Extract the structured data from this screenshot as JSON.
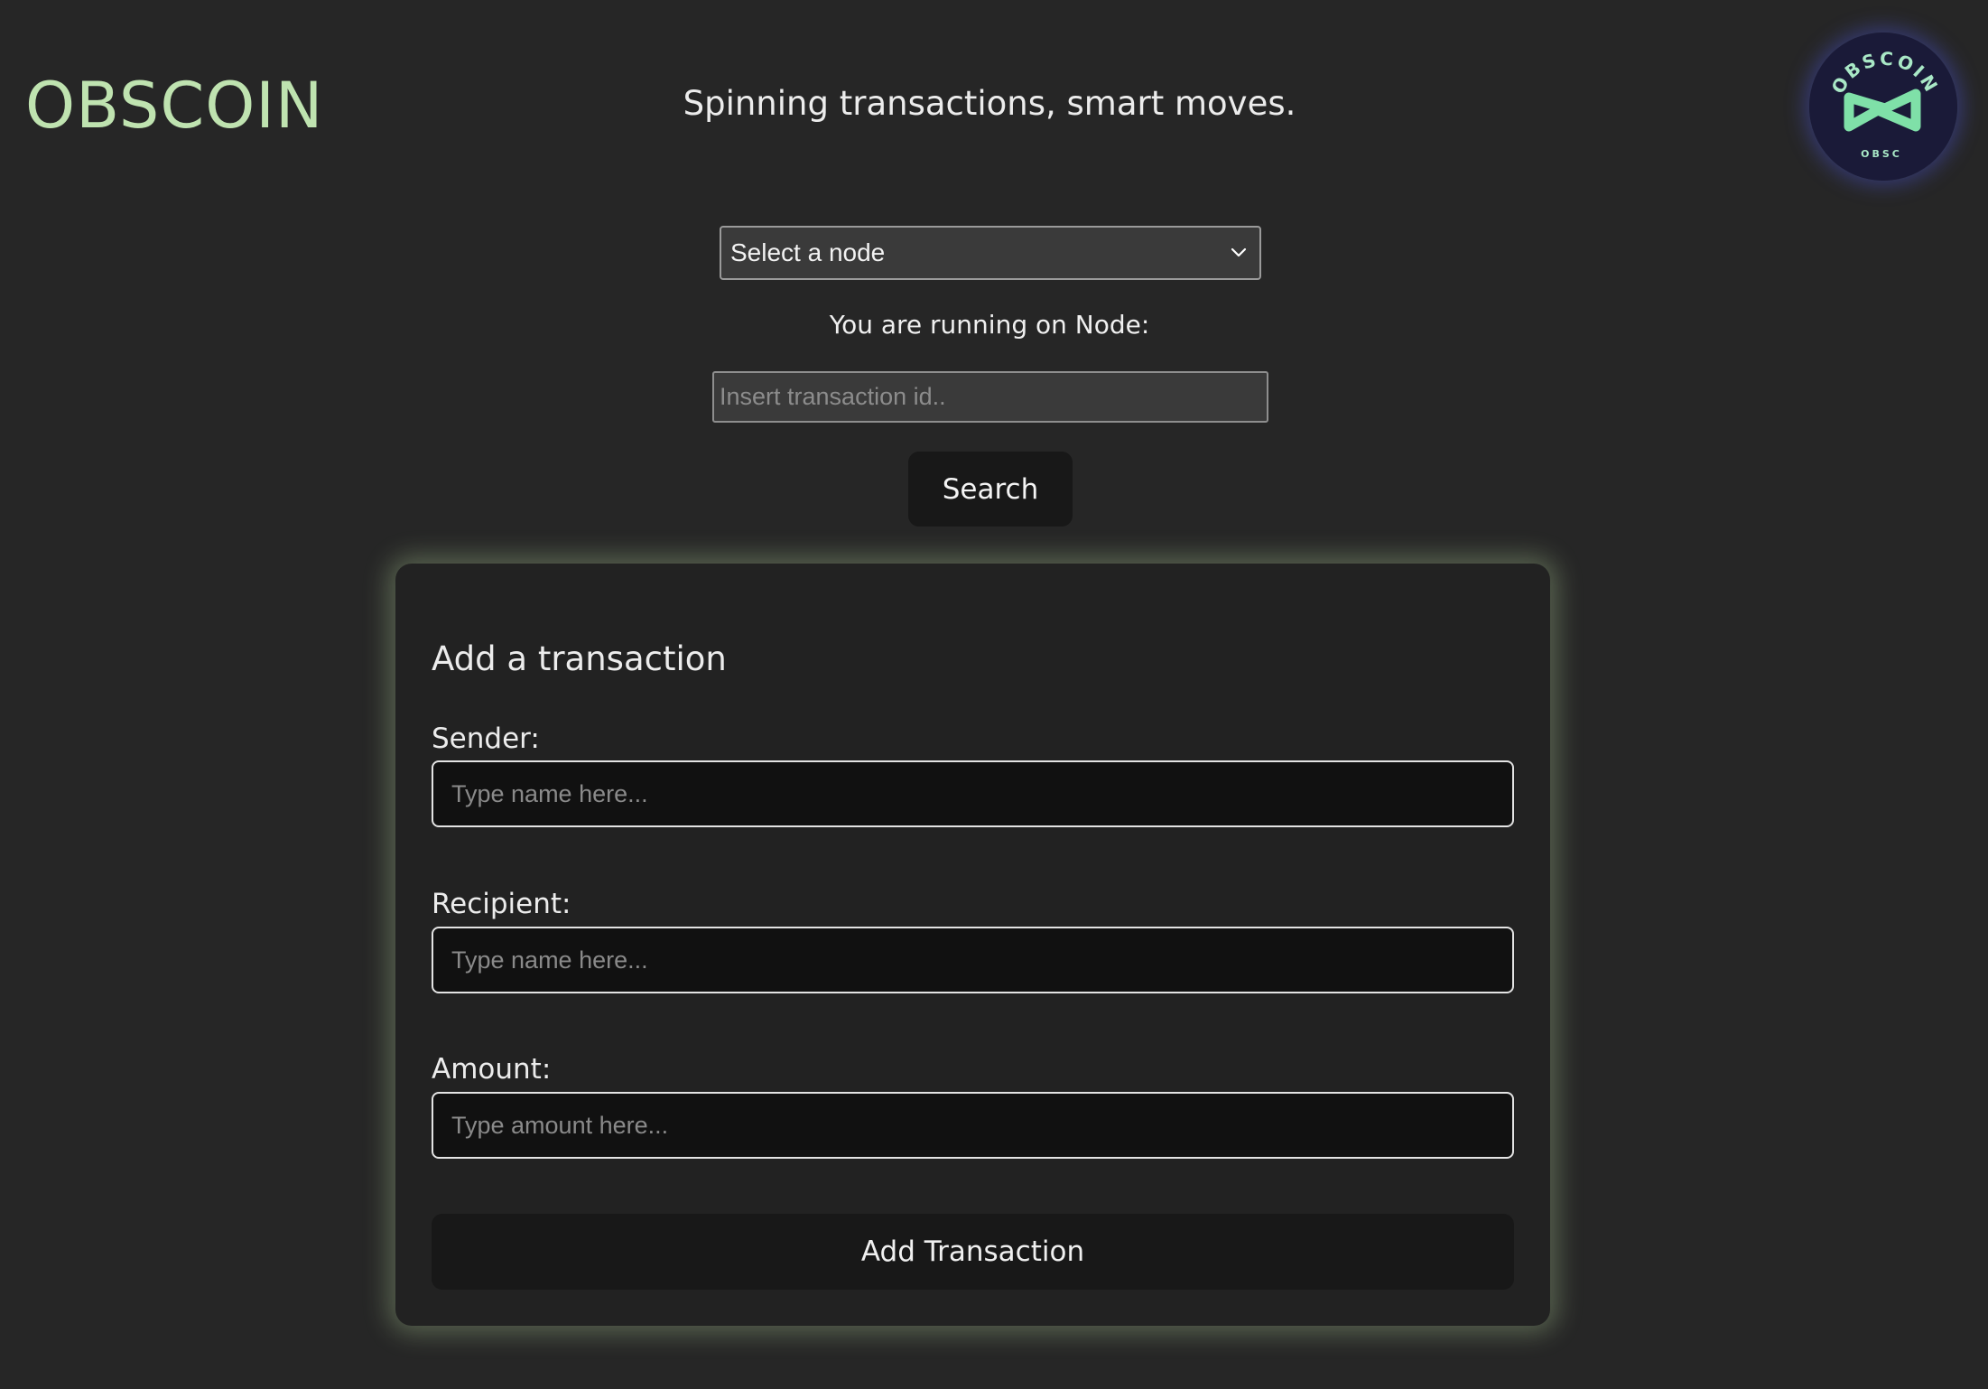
{
  "header": {
    "brand": "OBSCOIN",
    "tagline": "Spinning transactions, smart moves.",
    "logo": {
      "top_text": "OBSCOIN",
      "bottom_text": "OBSC",
      "icon": "infinity-icon",
      "bg_color": "#1a1a38",
      "accent_color": "#7fe0a8"
    }
  },
  "node_select": {
    "selected": "Select a node",
    "icon": "chevron-down-icon"
  },
  "status": {
    "running_label": "You are running on Node:"
  },
  "search": {
    "placeholder": "Insert transaction id..",
    "button_label": "Search"
  },
  "transaction_form": {
    "title": "Add a transaction",
    "sender_label": "Sender:",
    "sender_placeholder": "Type name here...",
    "recipient_label": "Recipient:",
    "recipient_placeholder": "Type name here...",
    "amount_label": "Amount:",
    "amount_placeholder": "Type amount here...",
    "submit_label": "Add Transaction"
  },
  "colors": {
    "background": "#262626",
    "brand_accent": "#bfe3b0",
    "card_glow": "#bee1a5",
    "button_bg": "#181818"
  }
}
